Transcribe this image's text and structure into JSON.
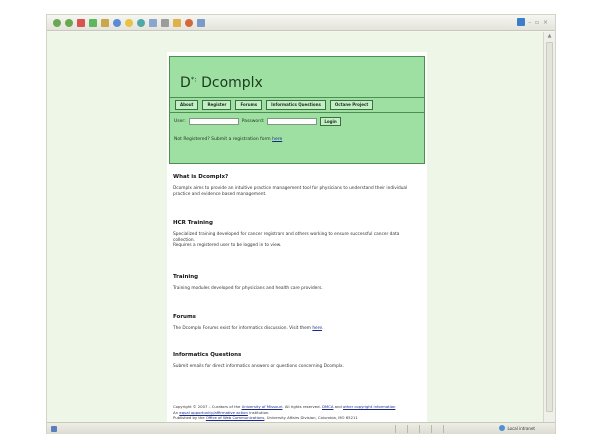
{
  "site": {
    "logo_prefix": "D",
    "logo_sup": "*:",
    "logo_name": "Dcomplx"
  },
  "nav": {
    "items": [
      {
        "label": "About"
      },
      {
        "label": "Register"
      },
      {
        "label": "Forums"
      },
      {
        "label": "Informatics Questions"
      },
      {
        "label": "Octane Project"
      }
    ]
  },
  "login": {
    "user_label": "User",
    "user_value": "",
    "password_label": "Password",
    "password_value": "",
    "button": "Login"
  },
  "register_prompt": {
    "text": "Not Registered? Submit a registration form",
    "link": "here"
  },
  "sections": [
    {
      "title": "What is Dcomplx?",
      "body": "Dcomplx aims to provide an intuitive practice management tool for physicians to understand their individual practice and evidence based management."
    },
    {
      "title": "HCR Training",
      "body": "Specialized training developed for cancer registrars and others working to ensure successful cancer data collection.",
      "body2": "Requires a registered user to be logged in to view."
    },
    {
      "title": "Training",
      "body": "Training modules developed for physicians and health care providers."
    },
    {
      "title": "Forums",
      "body": "The Dcomplx Forums exist for informatics discussion. Visit them",
      "link": "here"
    },
    {
      "title": "Informatics Questions",
      "body": "Submit emails for direct informatics answers or questions concerning Dcomplx."
    }
  ],
  "footer": {
    "line1_a": "Copyright © 2007 – Curators of the",
    "line1_link": "University of Missouri",
    "line1_b": ". All rights reserved.",
    "line1_link2": "DMCA",
    "line1_c": "and",
    "line1_link3": "other copyright information",
    "line2_a": "An",
    "line2_link": "equal opportunity/affirmative action",
    "line2_b": "institution.",
    "line3_a": "Published by the",
    "line3_link": "Office of Web Communications",
    "line3_b": ", University Affairs Division, Columbia, MO 65211"
  },
  "statusbar": {
    "zone": "Local intranet"
  },
  "colors": {
    "header_bg": "#9ee0a2",
    "header_border": "#4d8f52",
    "page_bg": "#eef6e7"
  },
  "icons": [
    "back-icon",
    "forward-icon",
    "stop-icon",
    "refresh-icon",
    "home-icon",
    "search-icon",
    "favorites-icon",
    "history-icon",
    "mail-icon",
    "print-icon",
    "edit-icon",
    "messenger-icon",
    "ie-logo-icon"
  ]
}
